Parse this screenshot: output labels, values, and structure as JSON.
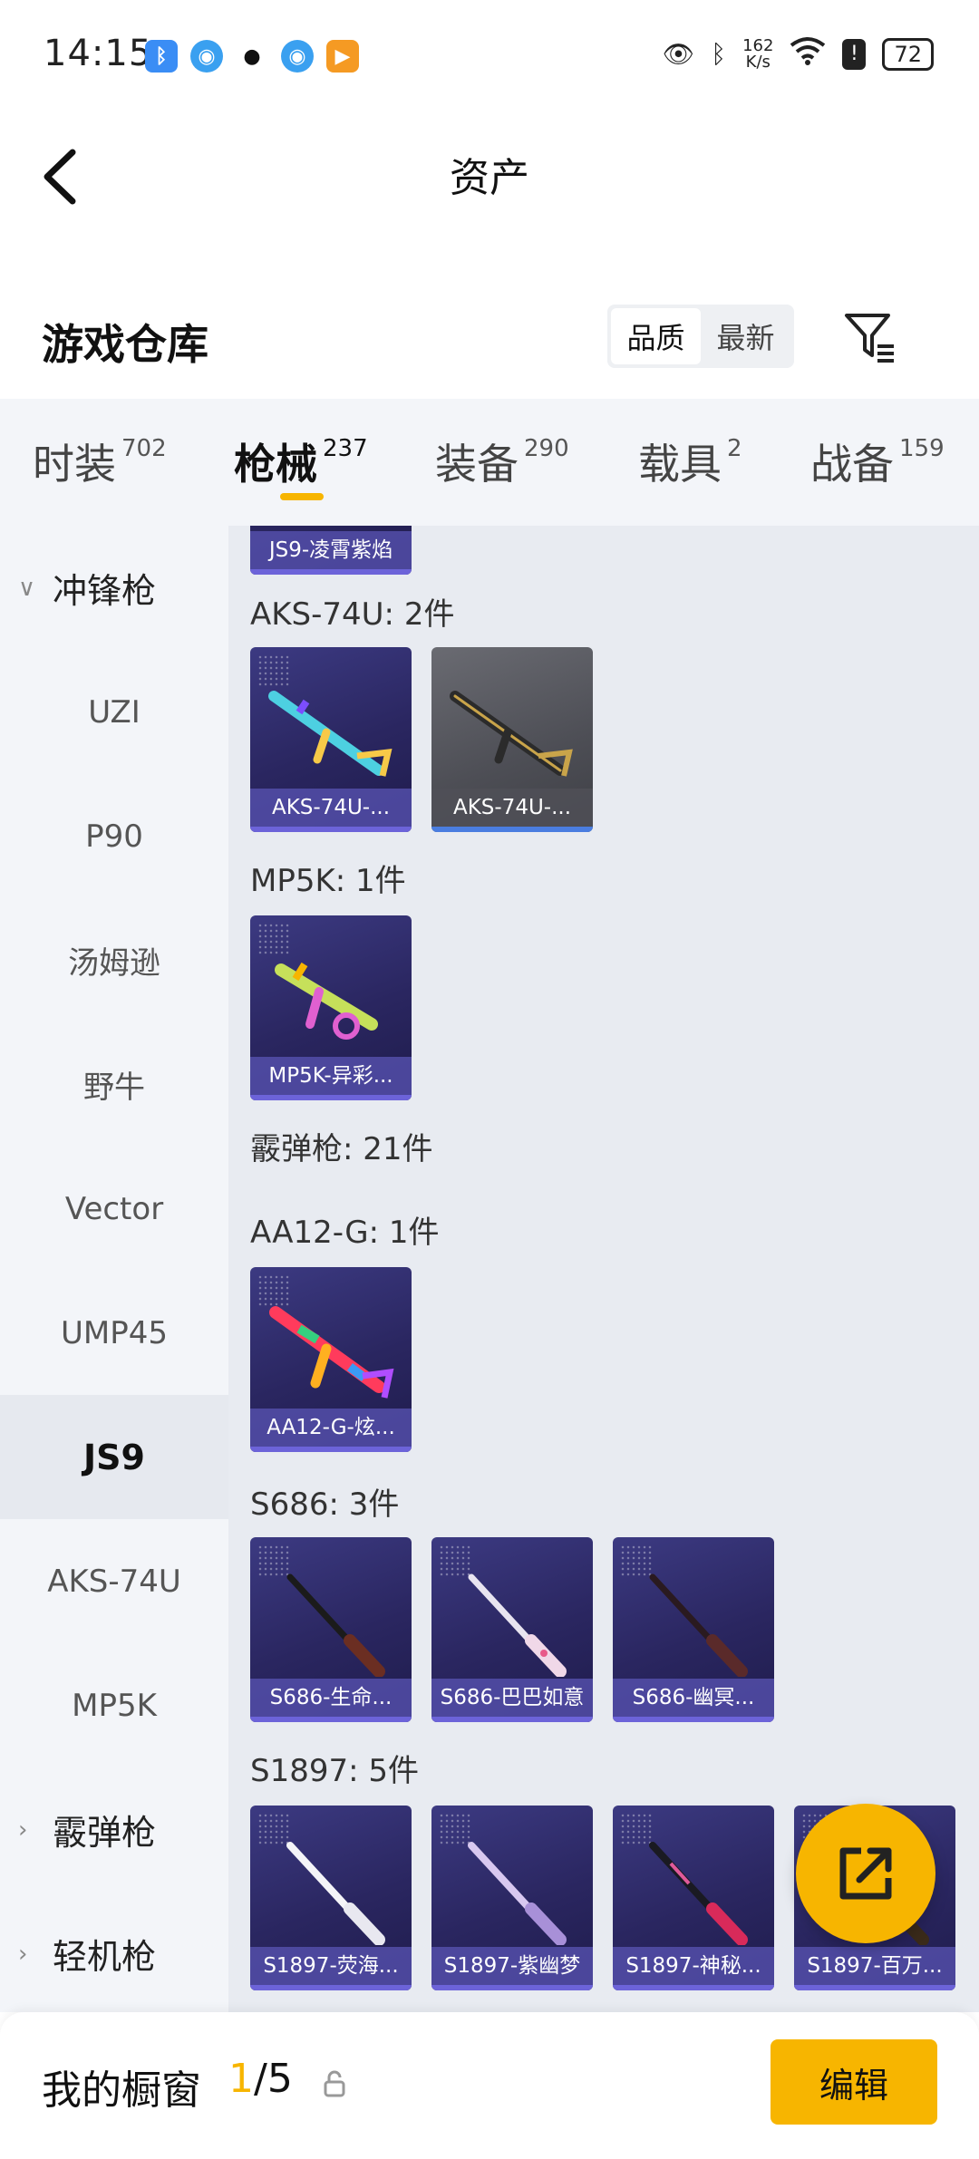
{
  "status": {
    "time": "14:15",
    "net_speed_value": "162",
    "net_speed_unit": "K/s",
    "battery": "72",
    "app_icons": [
      "bluetooth-app-icon",
      "browser-icon",
      "qq-icon",
      "browser-icon-2",
      "video-app-icon"
    ]
  },
  "header": {
    "title": "资产"
  },
  "warehouse": {
    "title": "游戏仓库",
    "sort_options": [
      "品质",
      "最新"
    ],
    "active_sort": "品质"
  },
  "tabs": [
    {
      "name": "时装",
      "count": "702"
    },
    {
      "name": "枪械",
      "count": "237",
      "active": true
    },
    {
      "name": "装备",
      "count": "290"
    },
    {
      "name": "载具",
      "count": "2"
    },
    {
      "name": "战备",
      "count": "159"
    }
  ],
  "sidebar": {
    "group_smg": "冲锋枪",
    "items": [
      "UZI",
      "P90",
      "汤姆逊",
      "野牛",
      "Vector",
      "UMP45",
      "JS9",
      "AKS-74U",
      "MP5K"
    ],
    "active_item": "JS9",
    "group_shotgun": "霰弹枪",
    "group_lmg": "轻机枪"
  },
  "content": {
    "top_card_label": "JS9-凌霄紫焰",
    "sections": {
      "aks": {
        "label": "AKS-74U: 2件",
        "cards": [
          "AKS-74U-...",
          "AKS-74U-..."
        ]
      },
      "mp5k": {
        "label": "MP5K: 1件",
        "cards": [
          "MP5K-异彩..."
        ]
      },
      "shotgun_total": {
        "label": "霰弹枪: 21件"
      },
      "aa12": {
        "label": "AA12-G: 1件",
        "cards": [
          "AA12-G-炫..."
        ]
      },
      "s686": {
        "label": "S686: 3件",
        "cards": [
          "S686-生命...",
          "S686-巴巴如意",
          "S686-幽冥..."
        ]
      },
      "s1897": {
        "label": "S1897: 5件",
        "cards": [
          "S1897-荧海...",
          "S1897-紫幽梦",
          "S1897-神秘...",
          "S1897-百万..."
        ]
      }
    }
  },
  "bottom": {
    "title": "我的橱窗",
    "current": "1",
    "total": "/5",
    "edit_label": "编辑"
  },
  "colors": {
    "accent": "#f7b500",
    "card_purple": "#2a2660",
    "side_bg": "#f3f5f9",
    "content_bg": "#e8ebf1"
  }
}
